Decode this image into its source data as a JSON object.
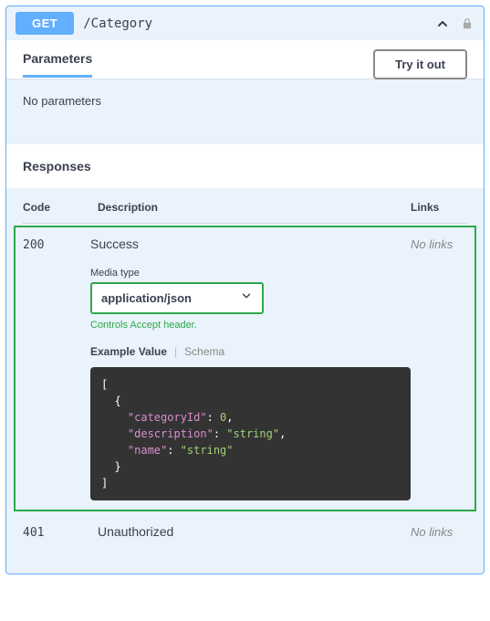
{
  "header": {
    "method": "GET",
    "path": "/Category"
  },
  "parameters": {
    "title": "Parameters",
    "try_label": "Try it out",
    "empty_text": "No parameters"
  },
  "responses": {
    "title": "Responses",
    "cols": {
      "code": "Code",
      "description": "Description",
      "links": "Links"
    },
    "rows": [
      {
        "code": "200",
        "description": "Success",
        "links": "No links",
        "highlighted": true,
        "media": {
          "label": "Media type",
          "selected": "application/json",
          "hint": "Controls Accept header."
        },
        "tabs": {
          "example": "Example Value",
          "schema": "Schema"
        },
        "example": {
          "l1": "[",
          "l2": "  {",
          "l3a": "    \"categoryId\"",
          "l3b": ": ",
          "l3c": "0",
          "l3d": ",",
          "l4a": "    \"description\"",
          "l4b": ": ",
          "l4c": "\"string\"",
          "l4d": ",",
          "l5a": "    \"name\"",
          "l5b": ": ",
          "l5c": "\"string\"",
          "l6": "  }",
          "l7": "]"
        }
      },
      {
        "code": "401",
        "description": "Unauthorized",
        "links": "No links"
      }
    ]
  }
}
